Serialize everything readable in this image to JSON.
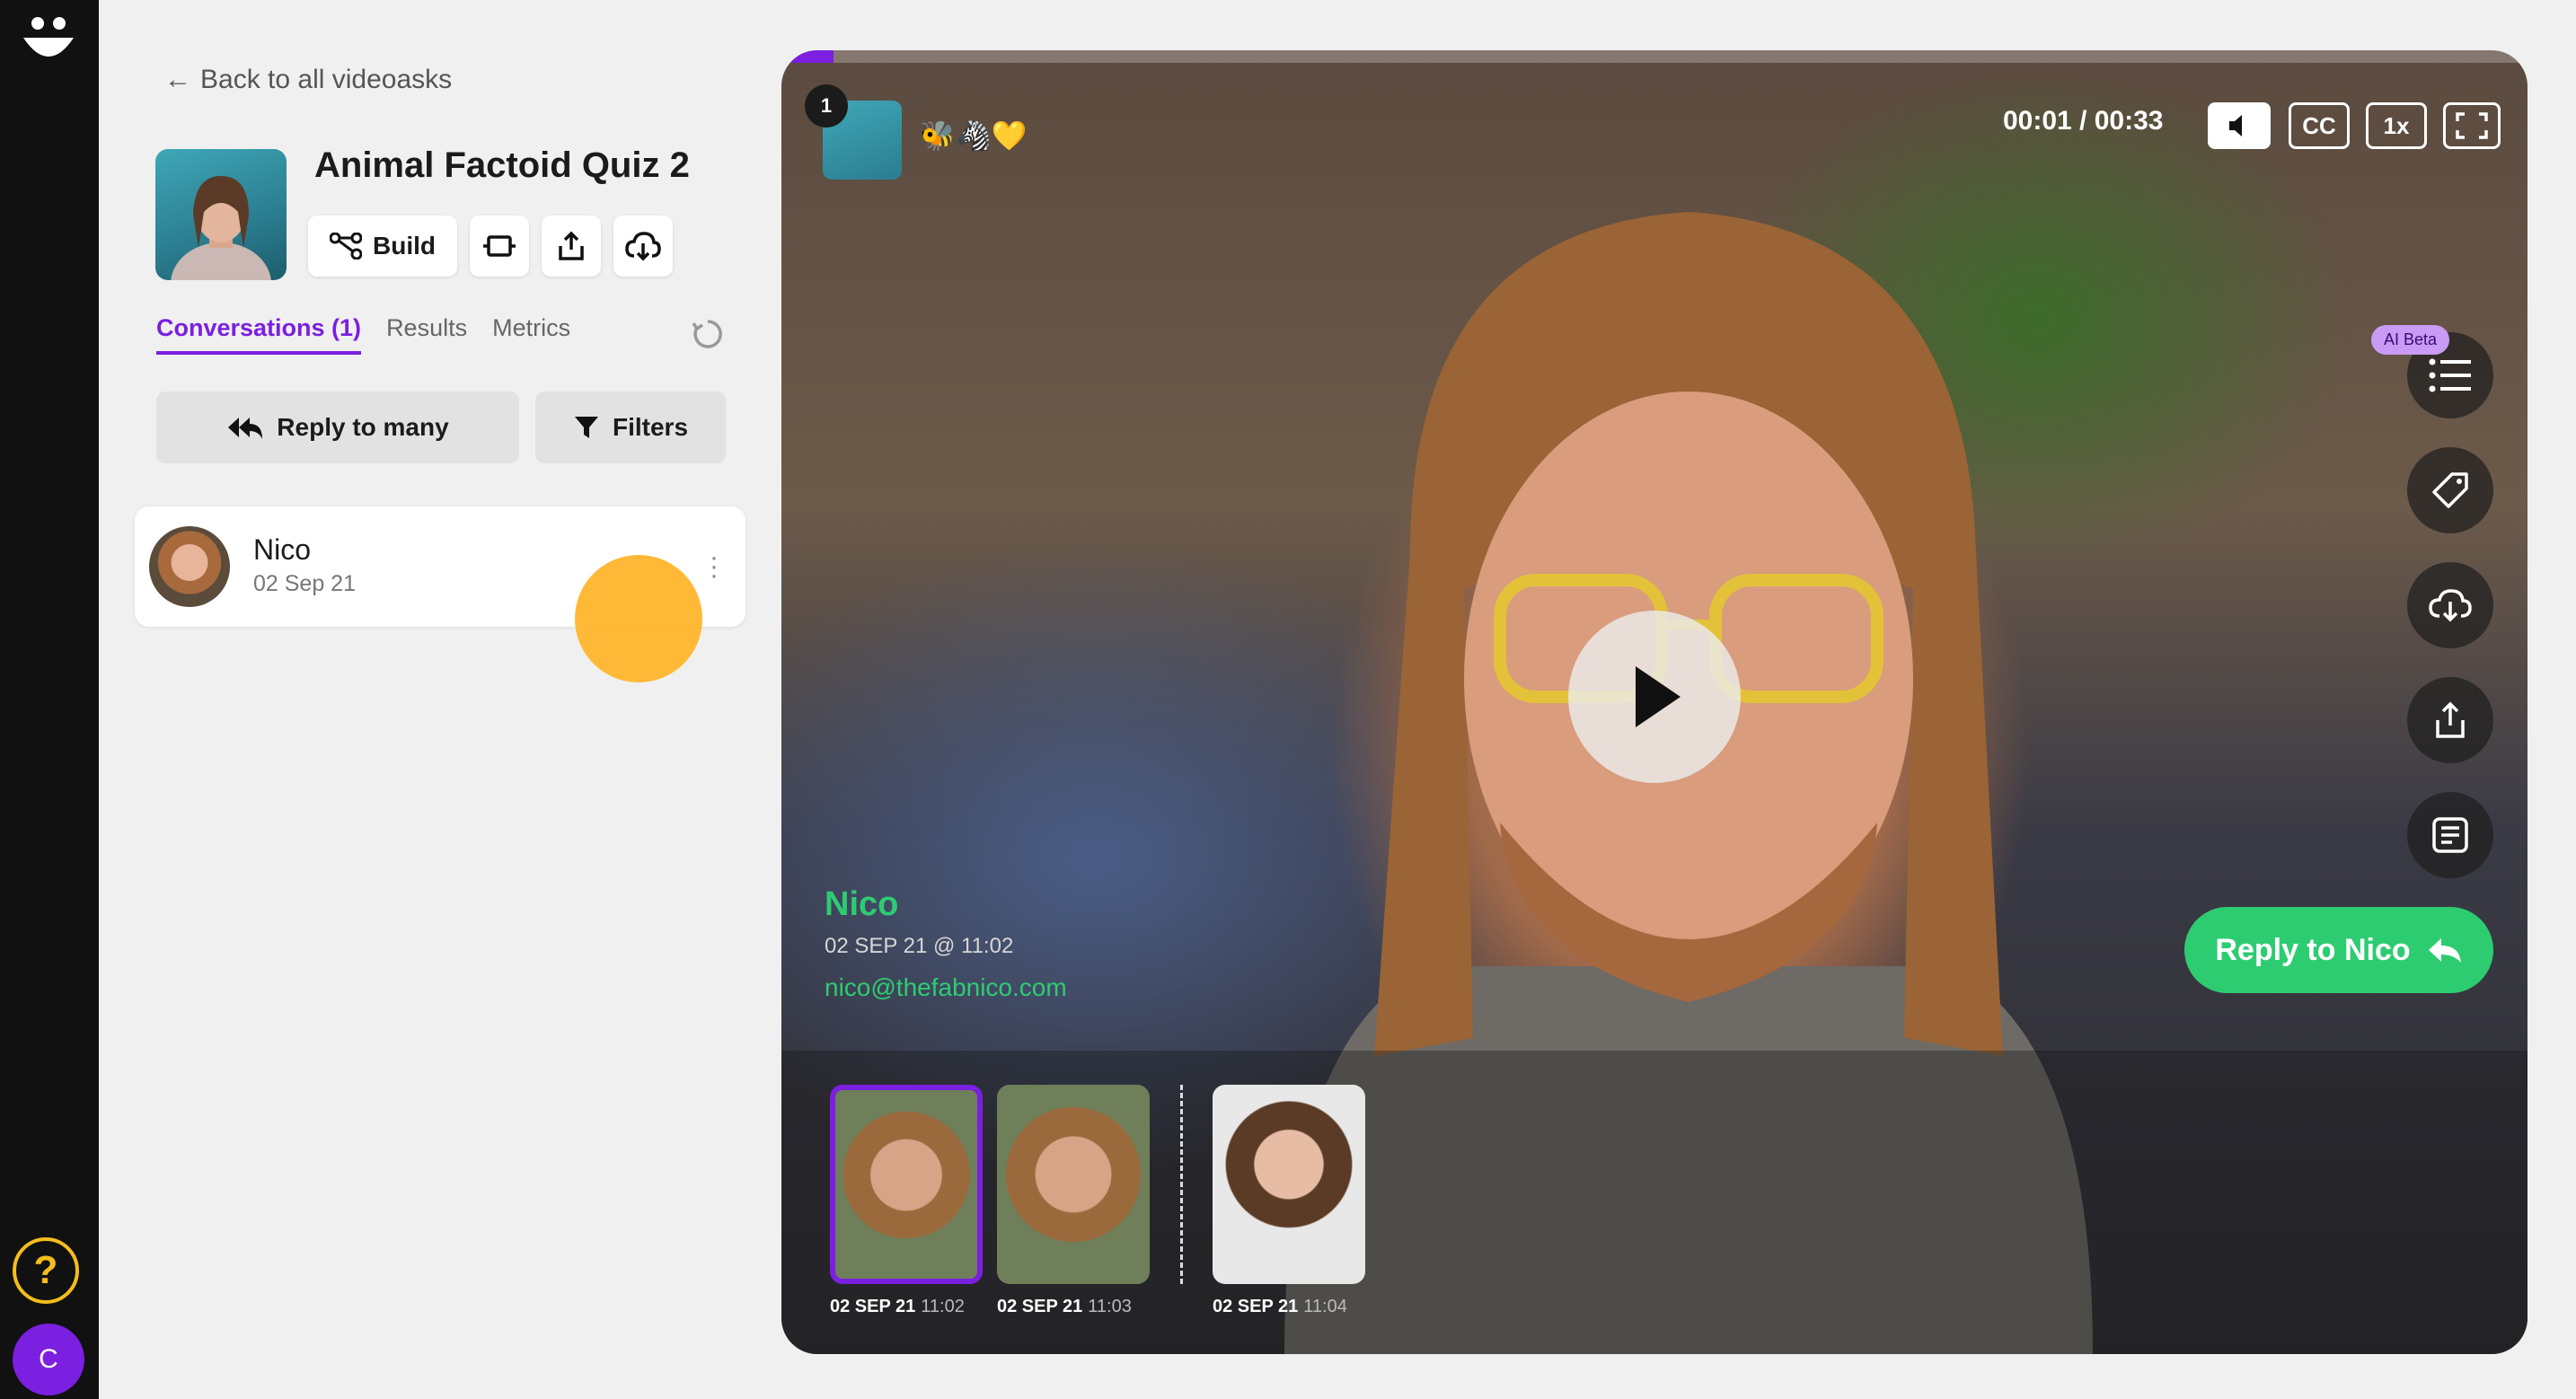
{
  "sidebar": {
    "logo_icon": "smiley-logo-icon",
    "help_label": "?",
    "user_initial": "C"
  },
  "header": {
    "back_label": "Back to all videoasks",
    "title": "Animal Factoid Quiz 2",
    "build_label": "Build"
  },
  "tabs": [
    {
      "label": "Conversations (1)",
      "active": true
    },
    {
      "label": "Results",
      "active": false
    },
    {
      "label": "Metrics",
      "active": false
    }
  ],
  "actions": {
    "reply_many_label": "Reply to many",
    "filters_label": "Filters"
  },
  "conversations": [
    {
      "name": "Nico",
      "date": "02 Sep 21"
    }
  ],
  "player": {
    "progress_fraction": 0.03,
    "step_number": "1",
    "step_emoji": "🐝🦓💛",
    "time": "00:01 / 00:33",
    "cc_label": "CC",
    "speed_label": "1x",
    "ai_badge": "AI Beta",
    "responder": {
      "name": "Nico",
      "datetime": "02 SEP 21 @ 11:02",
      "email": "nico@thefabnico.com"
    },
    "reply_label": "Reply to Nico",
    "clips": [
      {
        "date": "02 SEP 21",
        "time": "11:02",
        "selected": true
      },
      {
        "date": "02 SEP 21",
        "time": "11:03",
        "selected": false
      },
      {
        "date": "02 SEP 21",
        "time": "11:04",
        "selected": false
      }
    ]
  },
  "colors": {
    "accent": "#7b1fe0",
    "green": "#2ecc71",
    "yellow": "#f5bd1c",
    "cursor": "#ffb52b"
  }
}
